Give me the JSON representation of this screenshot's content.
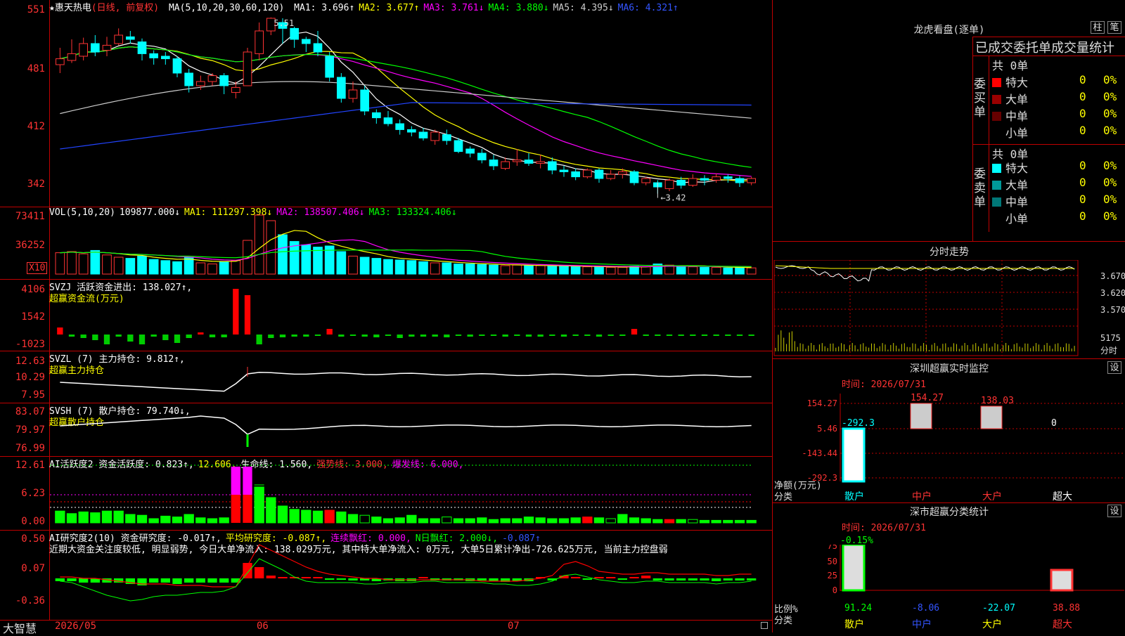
{
  "main": {
    "title": "★惠天热电",
    "title_mode": "(日线, 前复权)",
    "ma_label": "MA(5,10,20,30,60,120)",
    "ma_items": [
      {
        "text": "MA1: 3.696↑",
        "color": "#ffffff"
      },
      {
        "text": "MA2: 3.677↑",
        "color": "#ffff00"
      },
      {
        "text": "MA3: 3.761↓",
        "color": "#ff00ff"
      },
      {
        "text": "MA4: 3.880↓",
        "color": "#00ff00"
      },
      {
        "text": "MA5: 4.395↓",
        "color": "#cccccc"
      },
      {
        "text": "MA6: 4.321↑",
        "color": "#3355ff"
      }
    ],
    "y_ticks": [
      "551",
      "481",
      "412",
      "342"
    ],
    "high_label": "5.51",
    "low_label": "3.42"
  },
  "vol": {
    "label": "VOL(5,10,20)",
    "items": [
      {
        "text": "109877.000↓",
        "color": "#ffffff"
      },
      {
        "text": "MA1: 111297.398↓",
        "color": "#ffff00"
      },
      {
        "text": "MA2: 138507.406↓",
        "color": "#ff00ff"
      },
      {
        "text": "MA3: 133324.406↓",
        "color": "#00ff00"
      }
    ],
    "y_ticks": [
      "73411",
      "36252"
    ],
    "unit": "X10"
  },
  "svzj": {
    "label": "SVZJ  活跃资金进出: 138.027↑,",
    "sub": "超赢资金流(万元)",
    "y_ticks": [
      "4106",
      "1542",
      "-1023"
    ]
  },
  "svzl": {
    "label": "SVZL (7) 主力持仓: 9.812↑,",
    "sub": "超赢主力持仓",
    "y_ticks": [
      "12.63",
      "10.29",
      "7.95"
    ]
  },
  "svsh": {
    "label": "SVSH (7) 散户持仓: 79.740↓,",
    "sub": "超赢散户持仓",
    "y_ticks": [
      "83.07",
      "79.97",
      "76.99"
    ]
  },
  "ai1": {
    "items": [
      {
        "text": "AI活跃度2 资金活跃度: 0.823↑,",
        "color": "#ffffff"
      },
      {
        "text": "12.606,",
        "color": "#ffff00"
      },
      {
        "text": "生命线: 1.560,",
        "color": "#ffffff"
      },
      {
        "text": "强势线: 3.000,",
        "color": "#ff3333"
      },
      {
        "text": "爆发线: 6.000,",
        "color": "#ff00ff"
      }
    ],
    "y_ticks": [
      "12.61",
      "6.23",
      "0.00"
    ]
  },
  "ai2": {
    "items": [
      {
        "text": "AI研究度2(10) 资金研究度: -0.017↑,",
        "color": "#ffffff"
      },
      {
        "text": "平均研究度: -0.087↑,",
        "color": "#ffff00"
      },
      {
        "text": "连续飘红: 0.000,",
        "color": "#ff00ff"
      },
      {
        "text": "N日飘红: 2.000↓,",
        "color": "#00ff00"
      },
      {
        "text": "-0.087↑",
        "color": "#3355ff"
      }
    ],
    "summary": "近期大资金关注度较低, 明显弱势, 今日大单净流入: 138.029万元, 其中特大单净流入: 0万元, 大单5日累计净出-726.625万元, 当前主力控盘弱",
    "y_ticks": [
      "0.50",
      "0.07",
      "-0.36"
    ]
  },
  "footer": {
    "brand": "大智慧",
    "dates": [
      "2026/05",
      "06",
      "07"
    ]
  },
  "right": {
    "dragon_title": "龙虎看盘(逐单)",
    "btn_zhu": "柱",
    "btn_bi": "笔",
    "stats_title": "已成交委托单成交量统计",
    "buy_label": "委买单",
    "sell_label": "委卖单",
    "buy_total": "共 0单",
    "sell_total": "共 0单",
    "buy_rows": [
      {
        "name": "特大",
        "color": "#ff0000",
        "val": "0",
        "pct": "0%"
      },
      {
        "name": "大单",
        "color": "#990000",
        "val": "0",
        "pct": "0%"
      },
      {
        "name": "中单",
        "color": "#660000",
        "val": "0",
        "pct": "0%"
      },
      {
        "name": "小单",
        "color": "#000000",
        "val": "0",
        "pct": "0%"
      }
    ],
    "sell_rows": [
      {
        "name": "特大",
        "color": "#00ffff",
        "val": "0",
        "pct": "0%"
      },
      {
        "name": "大单",
        "color": "#009999",
        "val": "0",
        "pct": "0%"
      },
      {
        "name": "中单",
        "color": "#007777",
        "val": "0",
        "pct": "0%"
      },
      {
        "name": "小单",
        "color": "#000000",
        "val": "0",
        "pct": "0%"
      }
    ],
    "intraday_title": "分时走势",
    "intraday_ticks": [
      "3.670",
      "3.620",
      "3.570"
    ],
    "intraday_vol": "5175",
    "intraday_vol_lbl": "分时",
    "sz_title": "深圳超赢实时监控",
    "sz_btn": "设",
    "sz_time": "时间: 2026/07/31",
    "sz_ticks": [
      "154.27",
      "5.46",
      "-143.44",
      "-292.3"
    ],
    "sz_bar_vals": [
      "-292.3",
      "154.27",
      "138.03",
      "0"
    ],
    "sz_ylabel": "净额(万元)",
    "sz_xlabel": "分类",
    "sz_cats": [
      {
        "name": "散户",
        "color": "#00ffff"
      },
      {
        "name": "中户",
        "color": "#ff3333"
      },
      {
        "name": "大户",
        "color": "#ff3333"
      },
      {
        "name": "超大",
        "color": "#ffffff"
      }
    ],
    "cls_title": "深市超赢分类统计",
    "cls_btn": "设",
    "cls_time": "时间: 2026/07/31",
    "cls_top": "-0.15%",
    "cls_ticks": [
      "75",
      "50",
      "25",
      "0"
    ],
    "cls_ylabel": "比例%",
    "cls_xlabel": "分类",
    "cls_vals": [
      {
        "text": "91.24",
        "color": "#00ff00"
      },
      {
        "text": "-8.06",
        "color": "#3355ff"
      },
      {
        "text": "-22.07",
        "color": "#00ffff"
      },
      {
        "text": "38.88",
        "color": "#ff3333"
      }
    ],
    "cls_cats": [
      {
        "name": "散户",
        "color": "#ffff00"
      },
      {
        "name": "中户",
        "color": "#3355ff"
      },
      {
        "name": "大户",
        "color": "#ffff00"
      },
      {
        "name": "超大",
        "color": "#ff3333"
      }
    ]
  },
  "chart_data": {
    "type": "candlestick",
    "title": "",
    "price_range": [
      3.42,
      5.51
    ],
    "y_ticks": [
      5.51,
      4.81,
      4.12,
      3.42
    ],
    "candles": [
      [
        4.95,
        5.02,
        4.85,
        5.15
      ],
      [
        5.0,
        5.08,
        4.97,
        5.25
      ],
      [
        5.05,
        5.2,
        5.0,
        5.27
      ],
      [
        5.2,
        5.1,
        5.05,
        5.3
      ],
      [
        5.12,
        5.18,
        5.05,
        5.28
      ],
      [
        5.2,
        5.3,
        5.18,
        5.38
      ],
      [
        5.28,
        5.25,
        5.2,
        5.35
      ],
      [
        5.22,
        5.08,
        5.0,
        5.26
      ],
      [
        5.08,
        5.03,
        4.95,
        5.12
      ],
      [
        5.05,
        5.02,
        4.95,
        5.1
      ],
      [
        5.02,
        4.85,
        4.8,
        5.05
      ],
      [
        4.85,
        4.7,
        4.62,
        4.9
      ],
      [
        4.7,
        4.75,
        4.65,
        4.82
      ],
      [
        4.75,
        4.82,
        4.7,
        4.85
      ],
      [
        4.82,
        4.7,
        4.6,
        4.85
      ],
      [
        4.62,
        4.68,
        4.55,
        4.75
      ],
      [
        4.7,
        5.1,
        4.7,
        5.15
      ],
      [
        5.08,
        5.35,
        5.0,
        5.45
      ],
      [
        5.35,
        5.5,
        5.3,
        5.51
      ],
      [
        5.45,
        5.38,
        5.2,
        5.5
      ],
      [
        5.38,
        5.25,
        5.15,
        5.4
      ],
      [
        5.25,
        5.2,
        5.1,
        5.28
      ],
      [
        5.2,
        5.1,
        5.05,
        5.35
      ],
      [
        5.05,
        4.8,
        4.75,
        5.1
      ],
      [
        4.8,
        4.55,
        4.5,
        4.85
      ],
      [
        4.55,
        4.65,
        4.5,
        4.75
      ],
      [
        4.65,
        4.4,
        4.35,
        4.7
      ],
      [
        4.38,
        4.32,
        4.25,
        4.42
      ],
      [
        4.32,
        4.25,
        4.22,
        4.4
      ],
      [
        4.25,
        4.18,
        4.12,
        4.3
      ],
      [
        4.18,
        4.15,
        4.1,
        4.22
      ],
      [
        4.15,
        4.08,
        4.05,
        4.2
      ],
      [
        4.05,
        4.15,
        4.0,
        4.18
      ],
      [
        4.12,
        4.05,
        4.0,
        4.18
      ],
      [
        4.05,
        3.92,
        3.9,
        4.08
      ],
      [
        3.95,
        3.9,
        3.85,
        3.98
      ],
      [
        3.9,
        3.82,
        3.78,
        3.95
      ],
      [
        3.82,
        3.75,
        3.7,
        3.88
      ],
      [
        3.72,
        3.8,
        3.7,
        3.85
      ],
      [
        3.8,
        3.82,
        3.75,
        3.95
      ],
      [
        3.82,
        3.78,
        3.75,
        3.9
      ],
      [
        3.78,
        3.8,
        3.72,
        3.88
      ],
      [
        3.8,
        3.7,
        3.65,
        3.85
      ],
      [
        3.7,
        3.68,
        3.62,
        3.75
      ],
      [
        3.68,
        3.62,
        3.58,
        3.72
      ],
      [
        3.62,
        3.7,
        3.6,
        3.72
      ],
      [
        3.7,
        3.6,
        3.55,
        3.72
      ],
      [
        3.6,
        3.65,
        3.58,
        3.7
      ],
      [
        3.65,
        3.68,
        3.6,
        3.72
      ],
      [
        3.68,
        3.55,
        3.52,
        3.7
      ],
      [
        3.55,
        3.6,
        3.52,
        3.62
      ],
      [
        3.55,
        3.5,
        3.42,
        3.58
      ],
      [
        3.48,
        3.58,
        3.45,
        3.6
      ],
      [
        3.58,
        3.52,
        3.48,
        3.62
      ],
      [
        3.52,
        3.6,
        3.5,
        3.65
      ],
      [
        3.6,
        3.58,
        3.52,
        3.64
      ],
      [
        3.58,
        3.62,
        3.55,
        3.66
      ],
      [
        3.62,
        3.6,
        3.55,
        3.65
      ],
      [
        3.6,
        3.55,
        3.5,
        3.63
      ],
      [
        3.55,
        3.6,
        3.52,
        3.62
      ]
    ]
  }
}
